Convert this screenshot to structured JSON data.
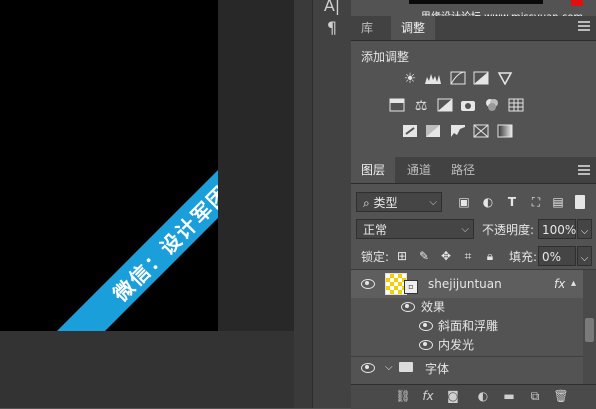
{
  "canvas": {
    "banner_text": "微信：设计军团"
  },
  "toolstrip": {
    "tool1": "A|",
    "tool2": "¶"
  },
  "watermark": "思缘设计论坛  www.missyuan.com",
  "top_panel": {
    "tabs": [
      {
        "label": "库"
      },
      {
        "label": "调整"
      }
    ],
    "active_tab": "调整",
    "add_adjustment_label": "添加调整",
    "icons_row1": [
      "brightness-icon",
      "levels-icon",
      "curves-icon",
      "exposure-icon",
      "vibrance-icon"
    ],
    "icons_row2": [
      "hue-saturation-icon",
      "color-balance-icon",
      "black-white-icon",
      "photo-filter-icon",
      "channel-mixer-icon",
      "color-lookup-icon"
    ],
    "icons_row3": [
      "invert-icon",
      "posterize-icon",
      "threshold-icon",
      "selective-color-icon",
      "gradient-map-icon"
    ]
  },
  "layers_panel": {
    "tabs": [
      {
        "label": "图层"
      },
      {
        "label": "通道"
      },
      {
        "label": "路径"
      }
    ],
    "active_tab": "图层",
    "filter_kind": "类型",
    "blend_mode": "正常",
    "opacity_label": "不透明度:",
    "opacity_value": "100%",
    "lock_label": "锁定:",
    "fill_label": "填充:",
    "fill_value": "0%",
    "layers": [
      {
        "name": "shejijuntuan",
        "fx": "fx"
      },
      {
        "name": "效果"
      },
      {
        "name": "斜面和浮雕"
      },
      {
        "name": "内发光"
      },
      {
        "name": "字体"
      }
    ]
  },
  "colors": {
    "banner": "#1a9fdb",
    "watermark_red": "#e01010"
  }
}
